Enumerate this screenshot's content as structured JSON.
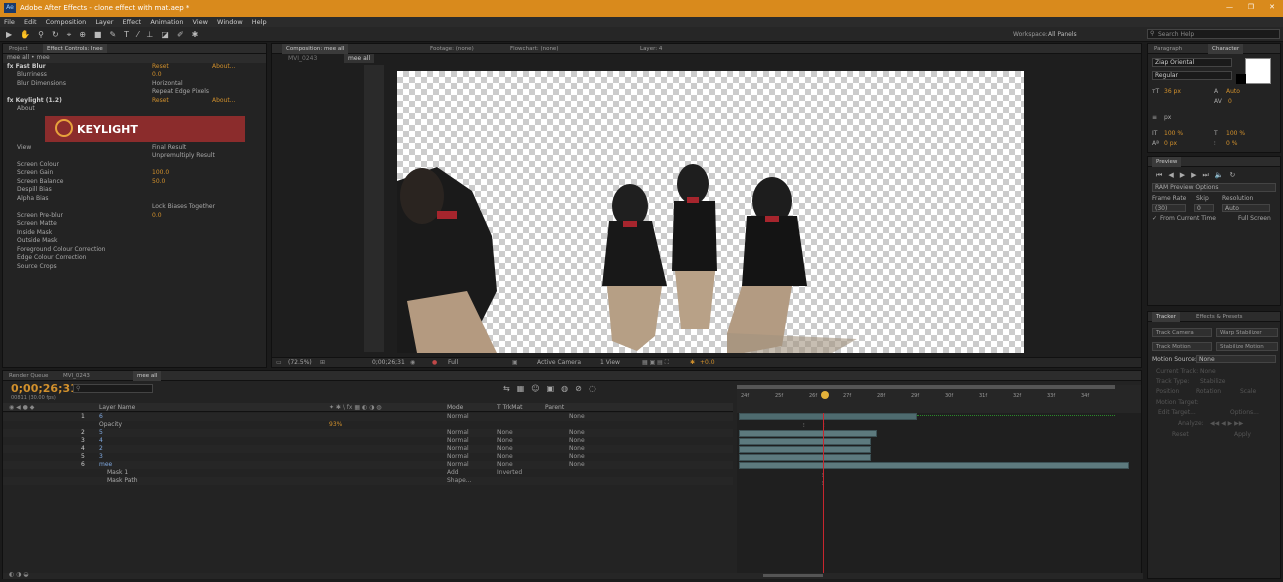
{
  "window": {
    "title": "Adobe After Effects - clone effect with mat.aep *",
    "controls": [
      "—",
      "❐",
      "✕"
    ]
  },
  "menu": [
    "File",
    "Edit",
    "Composition",
    "Layer",
    "Effect",
    "Animation",
    "View",
    "Window",
    "Help"
  ],
  "toolbar": {
    "workspace_label": "Workspace:",
    "workspace_value": "All Panels",
    "search_placeholder": "Search Help"
  },
  "left_panel": {
    "tabs": [
      "Project",
      "Effect Controls: Inee"
    ],
    "header": "mee all • mee",
    "rows": [
      {
        "label": "fx Fast Blur",
        "value": "Reset",
        "extra": "About..."
      },
      {
        "label": "Blurriness",
        "value": "0.0"
      },
      {
        "label": "Blur Dimensions",
        "value": "Horizontal"
      },
      {
        "label": "",
        "value": "Repeat Edge Pixels"
      },
      {
        "label": "fx Keylight (1.2)",
        "value": "Reset",
        "extra": "About..."
      },
      {
        "label": "About",
        "value": ""
      }
    ],
    "logo_text": "KEYLIGHT",
    "rows2": [
      {
        "label": "View",
        "value": "Final Result"
      },
      {
        "label": "",
        "value": "Unpremultiply Result"
      },
      {
        "label": "Screen Colour",
        "value": ""
      },
      {
        "label": "Screen Gain",
        "value": "100.0"
      },
      {
        "label": "Screen Balance",
        "value": "50.0"
      },
      {
        "label": "Despill Bias",
        "value": ""
      },
      {
        "label": "Alpha Bias",
        "value": ""
      },
      {
        "label": "",
        "value": "Lock Biases Together"
      },
      {
        "label": "Screen Pre-blur",
        "value": "0.0"
      },
      {
        "label": "Screen Matte",
        "value": ""
      },
      {
        "label": "Inside Mask",
        "value": ""
      },
      {
        "label": "Outside Mask",
        "value": ""
      },
      {
        "label": "Foreground Colour Correction",
        "value": ""
      },
      {
        "label": "Edge Colour Correction",
        "value": ""
      },
      {
        "label": "Source Crops",
        "value": ""
      }
    ]
  },
  "comp_panel": {
    "tabs": [
      "Composition: mee all",
      "Footage: (none)",
      "Flowchart: (none)",
      "Layer: 4"
    ],
    "subtabs": [
      "MVI_0243",
      "mee all"
    ],
    "bottom": {
      "zoom": "(72.5%)",
      "timecode": "0;00;26;31",
      "resolution": "Full",
      "camera": "Active Camera",
      "views": "1 View",
      "offset": "+0.0"
    }
  },
  "right_panel": {
    "tabs": [
      "Paragraph",
      "Character"
    ],
    "font": "Ziap Oriental",
    "style": "Regular",
    "size": "36 px",
    "leading": "Auto",
    "tracking": "0",
    "unit": "px",
    "scale_v": "100 %",
    "scale_h": "100 %",
    "baseline": "0 px",
    "tsume": "0 %",
    "preview": {
      "tab": "Preview",
      "ram_label": "RAM Preview Options",
      "frame_rate": "Frame Rate",
      "skip": "Skip",
      "resolution": "Resolution",
      "frame_rate_value": "(30)",
      "skip_value": "0",
      "resolution_value": "Auto",
      "from_current": "From Current Time",
      "full_screen": "Full Screen"
    },
    "tracker": {
      "tabs": [
        "Tracker",
        "Effects & Presets"
      ],
      "buttons": [
        "Track Camera",
        "Warp Stabilizer",
        "Track Motion",
        "Stabilize Motion"
      ],
      "motion_source_label": "Motion Source:",
      "motion_source_value": "None",
      "current_track": "Current Track:",
      "current_track_value": "None",
      "track_type": "Track Type:",
      "track_type_value": "Stabilize",
      "checks": [
        "Position",
        "Rotation",
        "Scale"
      ],
      "motion_target": "Motion Target:",
      "edit_target": "Edit Target...",
      "options": "Options...",
      "analyze": "Analyze:",
      "reset": "Reset",
      "apply": "Apply"
    }
  },
  "timeline": {
    "tabs": [
      "Render Queue",
      "MVI_0243",
      "mee all"
    ],
    "timecode": "0;00;26;31",
    "fps": "00811 (30.00 fps)",
    "columns": [
      "Layer Name",
      "Mode",
      "T TrkMat",
      "Parent"
    ],
    "layers": [
      {
        "num": "1",
        "name": "6",
        "mode": "Normal",
        "trk": "",
        "parent": "None"
      },
      {
        "num": "",
        "name": "Opacity",
        "mode": "",
        "trk": "",
        "parent": "",
        "value": "93%"
      },
      {
        "num": "2",
        "name": "5",
        "mode": "Normal",
        "trk": "None",
        "parent": "None"
      },
      {
        "num": "3",
        "name": "4",
        "mode": "Normal",
        "trk": "None",
        "parent": "None"
      },
      {
        "num": "4",
        "name": "2",
        "mode": "Normal",
        "trk": "None",
        "parent": "None"
      },
      {
        "num": "5",
        "name": "3",
        "mode": "Normal",
        "trk": "None",
        "parent": "None"
      },
      {
        "num": "6",
        "name": "mee",
        "mode": "Normal",
        "trk": "None",
        "parent": "None"
      },
      {
        "num": "",
        "name": "Mask 1",
        "mode": "Add",
        "trk": "Inverted",
        "parent": ""
      },
      {
        "num": "",
        "name": "Mask Path",
        "mode": "Shape...",
        "trk": "",
        "parent": ""
      }
    ],
    "ruler": [
      "24f",
      "25f",
      "26f",
      "27f",
      "28f",
      "29f",
      "30f",
      "31f",
      "32f",
      "33f",
      "34f"
    ]
  },
  "accent_colors": {
    "titlebar": "#d98a1c",
    "playhead": "#c8262e",
    "layer_bar": "#5d7a7e"
  }
}
